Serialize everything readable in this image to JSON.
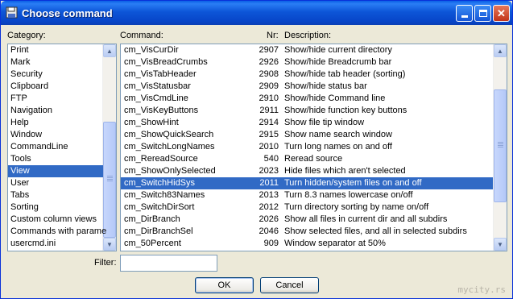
{
  "window": {
    "title": "Choose command"
  },
  "labels": {
    "category": "Category:",
    "command": "Command:",
    "nr": "Nr:",
    "description": "Description:",
    "filter": "Filter:"
  },
  "filter": {
    "value": ""
  },
  "buttons": {
    "ok": "OK",
    "cancel": "Cancel"
  },
  "categories": [
    "Print",
    "Mark",
    "Security",
    "Clipboard",
    "FTP",
    "Navigation",
    "Help",
    "Window",
    "CommandLine",
    "Tools",
    "View",
    "User",
    "Tabs",
    "Sorting",
    "Custom column views",
    "Commands with parame",
    "usercmd.ini"
  ],
  "selected_category": "View",
  "commands": [
    {
      "cmd": "cm_VisCurDir",
      "nr": "2907",
      "desc": "Show/hide current directory"
    },
    {
      "cmd": "cm_VisBreadCrumbs",
      "nr": "2926",
      "desc": "Show/hide Breadcrumb bar"
    },
    {
      "cmd": "cm_VisTabHeader",
      "nr": "2908",
      "desc": "Show/hide tab header (sorting)"
    },
    {
      "cmd": "cm_VisStatusbar",
      "nr": "2909",
      "desc": "Show/hide status bar"
    },
    {
      "cmd": "cm_VisCmdLine",
      "nr": "2910",
      "desc": "Show/hide Command line"
    },
    {
      "cmd": "cm_VisKeyButtons",
      "nr": "2911",
      "desc": "Show/hide function key buttons"
    },
    {
      "cmd": "cm_ShowHint",
      "nr": "2914",
      "desc": "Show file tip window"
    },
    {
      "cmd": "cm_ShowQuickSearch",
      "nr": "2915",
      "desc": "Show name search window"
    },
    {
      "cmd": "cm_SwitchLongNames",
      "nr": "2010",
      "desc": "Turn long names on and off"
    },
    {
      "cmd": "cm_RereadSource",
      "nr": "540",
      "desc": "Reread source"
    },
    {
      "cmd": "cm_ShowOnlySelected",
      "nr": "2023",
      "desc": "Hide files which aren't selected"
    },
    {
      "cmd": "cm_SwitchHidSys",
      "nr": "2011",
      "desc": "Turn hidden/system files on and off"
    },
    {
      "cmd": "cm_Switch83Names",
      "nr": "2013",
      "desc": "Turn 8.3 names lowercase on/off"
    },
    {
      "cmd": "cm_SwitchDirSort",
      "nr": "2012",
      "desc": "Turn directory sorting by name on/off"
    },
    {
      "cmd": "cm_DirBranch",
      "nr": "2026",
      "desc": "Show all files in current dir and all subdirs"
    },
    {
      "cmd": "cm_DirBranchSel",
      "nr": "2046",
      "desc": "Show selected files, and all in selected subdirs"
    },
    {
      "cmd": "cm_50Percent",
      "nr": "909",
      "desc": "Window separator at 50%"
    }
  ],
  "selected_command": "cm_SwitchHidSys",
  "watermark": "mycity.rs",
  "colors": {
    "selection": "#316ac5",
    "titlebar": "#0a5fe5"
  }
}
